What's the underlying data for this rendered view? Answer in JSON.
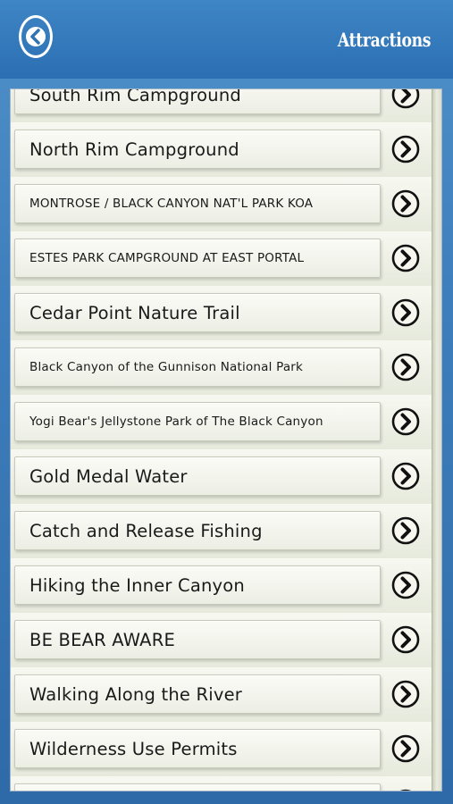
{
  "header": {
    "title": "Attractions",
    "back_icon": "chevron-left-circle-icon"
  },
  "colors": {
    "header_bg": "#2f73b5",
    "page_bg": "#3f7fbd",
    "row_bg": "#f3f4ec",
    "text": "#1a1a1a"
  },
  "list": {
    "items": [
      {
        "label": "South Rim Campground",
        "size": "lg"
      },
      {
        "label": "North Rim Campground",
        "size": "lg"
      },
      {
        "label": "MONTROSE / BLACK CANYON NAT'L PARK KOA",
        "size": "sm"
      },
      {
        "label": "ESTES PARK CAMPGROUND AT EAST PORTAL",
        "size": "sm"
      },
      {
        "label": "Cedar Point Nature Trail",
        "size": "lg"
      },
      {
        "label": "Black Canyon of the Gunnison National Park",
        "size": "sm"
      },
      {
        "label": "Yogi Bear's Jellystone Park of The Black Canyon",
        "size": "sm"
      },
      {
        "label": "Gold Medal Water",
        "size": "lg"
      },
      {
        "label": "Catch and Release Fishing",
        "size": "lg"
      },
      {
        "label": "Hiking the Inner Canyon",
        "size": "lg"
      },
      {
        "label": "BE BEAR AWARE",
        "size": "lg"
      },
      {
        "label": "Walking Along the River",
        "size": "lg"
      },
      {
        "label": "Wilderness Use Permits",
        "size": "lg"
      },
      {
        "label": "",
        "size": "lg"
      }
    ],
    "arrow_icon": "chevron-right-circle-icon"
  }
}
